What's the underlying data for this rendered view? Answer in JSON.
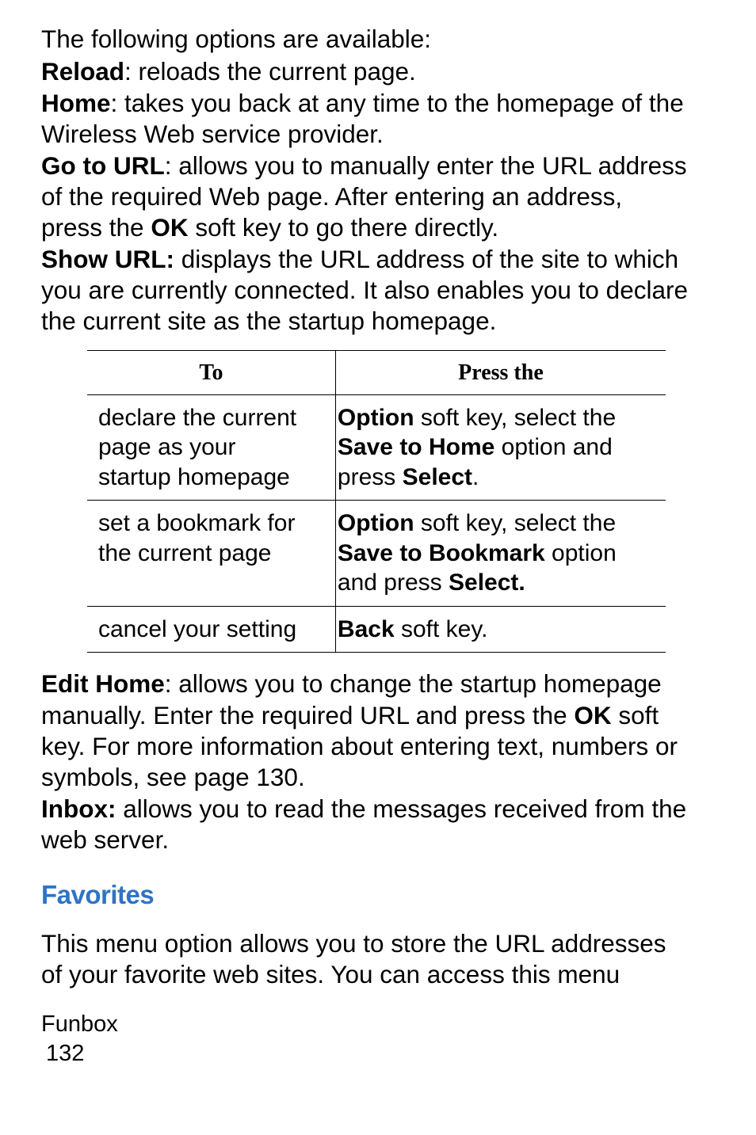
{
  "intro": "The following options are available:",
  "options": {
    "reload": {
      "label": "Reload",
      "desc": ": reloads the current page."
    },
    "home": {
      "label": "Home",
      "desc": ": takes you you back at any time to the homepage of the Wireless Web service provider."
    },
    "home_line1": ": takes you back at any time to the homepage of the",
    "home_line2": "Wireless Web service provider.",
    "gotourl": {
      "label": "Go to URL",
      "line1": ": allows you to manually enter the URL address",
      "line2": "of the required Web page. After entering an address,",
      "line3_pre": "press the ",
      "ok": "OK",
      "line3_post": " soft key to go there directly."
    },
    "showurl": {
      "label": "Show URL:",
      "line1": " displays the URL address of the site to which",
      "line2": "you are currently connected. It also enables you to declare",
      "line3": "the current site as the startup homepage."
    }
  },
  "table": {
    "headers": {
      "to": "To",
      "press": "Press the"
    },
    "rows": [
      {
        "to_l1": "declare the current",
        "to_l2": "page as your",
        "to_l3": "startup homepage",
        "press": {
          "b1": "Option",
          "t1": " soft key, select the",
          "b2": "Save to Home",
          "t2": " option and",
          "t3": "press ",
          "b3": "Select",
          "t4": "."
        }
      },
      {
        "to_l1": "set a bookmark for",
        "to_l2": "the current page",
        "press": {
          "b1": "Option",
          "t1": " soft key, select the",
          "b2": "Save to Bookmark",
          "t2": " option",
          "t3": "and press ",
          "b3": "Select.",
          "t4": ""
        }
      },
      {
        "to_l1": "cancel your setting",
        "press": {
          "b1": "Back",
          "t1": " soft key."
        }
      }
    ]
  },
  "after": {
    "edithome": {
      "label": "Edit Home",
      "t1": ": allows you to change the startup homepage",
      "t2": "manually. Enter the required URL and press the ",
      "ok": "OK",
      "t3": " soft",
      "t4": "key. For more information about entering text, numbers or",
      "t5": "symbols, see page 130."
    },
    "inbox": {
      "label": "Inbox:",
      "t1": " allows you to read the messages received from the",
      "t2": "web server."
    }
  },
  "section": {
    "title": "Favorites",
    "body_l1": "This menu option allows you to store the URL addresses",
    "body_l2": "of your favorite web sites. You can access this menu"
  },
  "footer": {
    "chapter": "Funbox",
    "page": "132"
  }
}
